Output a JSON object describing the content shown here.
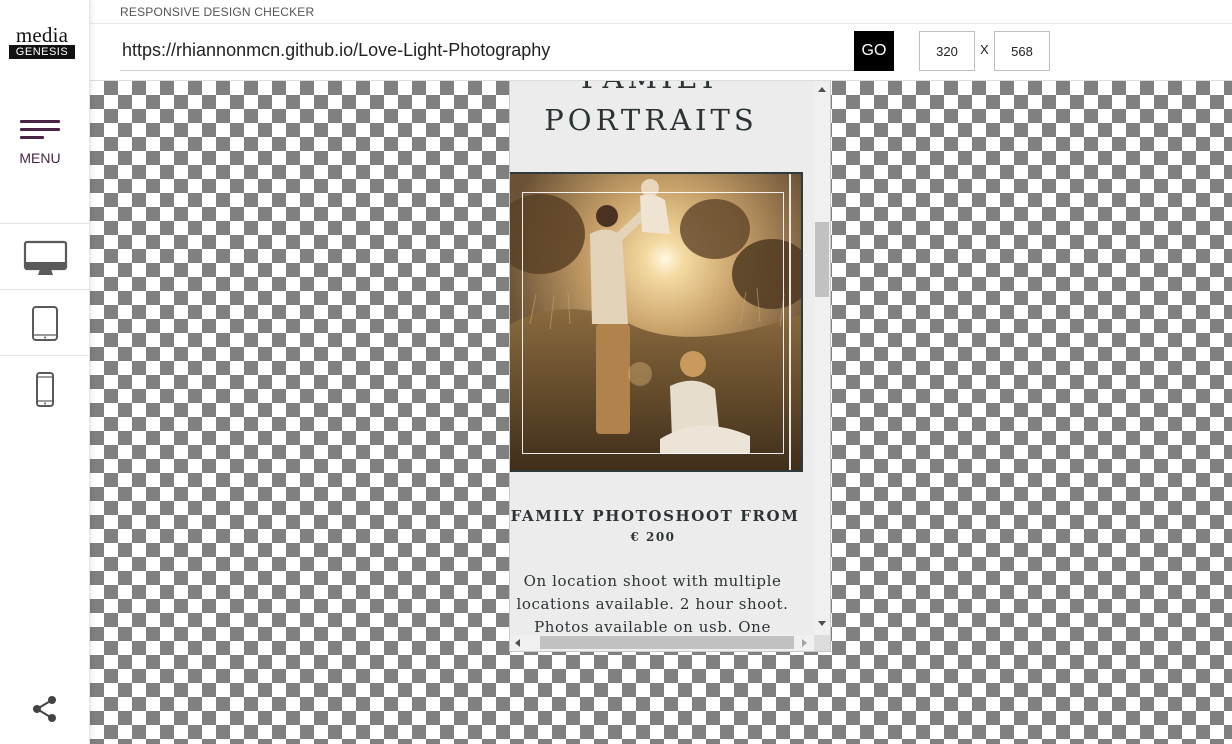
{
  "sidebar": {
    "logo": {
      "top_word": "media",
      "bottom_word": "GENESIS"
    },
    "menu_label": "MENU",
    "devices": [
      {
        "icon": "desktop-monitor-icon"
      },
      {
        "icon": "tablet-icon"
      },
      {
        "icon": "smartphone-icon"
      }
    ],
    "share_icon": "share-icon",
    "accent_color": "#4a2347"
  },
  "topbar": {
    "title": "RESPONSIVE DESIGN CHECKER",
    "url": "https://rhiannonmcn.github.io/Love-Light-Photography",
    "go_label": "GO",
    "width": "320",
    "height": "568",
    "dimension_separator": "X"
  },
  "preview": {
    "section_title_line1": "FAMILY",
    "section_title_line2": "PORTRAITS",
    "photo_description": "family-in-field-photo",
    "package_title": "FAMILY PHOTOSHOOT FROM",
    "package_price": "€ 200",
    "package_description_lines": [
      "On location shoot with multiple",
      "locations available. 2 hour shoot.",
      "Photos available on usb. One"
    ],
    "vertical_scroll_fraction": 0.25
  },
  "colors": {
    "go_button": "#000000",
    "checker_dark": "#808080",
    "checker_light": "#ffffff",
    "site_text": "#2b3335",
    "site_background": "#ececec"
  }
}
